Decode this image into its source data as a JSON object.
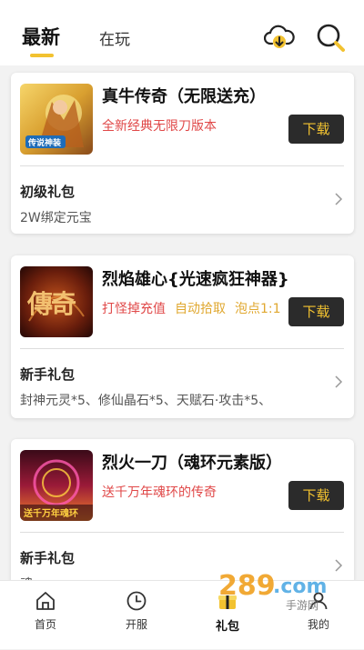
{
  "header": {
    "tabs": [
      {
        "label": "最新",
        "active": true
      },
      {
        "label": "在玩",
        "active": false
      }
    ],
    "icons": [
      "cloud-download-icon",
      "search-icon"
    ],
    "accent": "#f2c230"
  },
  "games": [
    {
      "title": "真牛传奇（无限送充）",
      "description": "全新经典无限刀版本",
      "tags": [],
      "thumb_text": "传说神装",
      "download_label": "下载",
      "gift_title": "初级礼包",
      "gift_content": "2W绑定元宝"
    },
    {
      "title": "烈焰雄心{光速疯狂神器}",
      "description": "",
      "tags": [
        {
          "text": "打怪掉充值",
          "color": "#e04848"
        },
        {
          "text": "自动拾取",
          "color": "#e0a830"
        },
        {
          "text": "泡点1:1",
          "color": "#e0a830"
        }
      ],
      "thumb_text": "傳奇",
      "download_label": "下载",
      "gift_title": "新手礼包",
      "gift_content": "封神元灵*5、修仙晶石*5、天赋石·攻击*5、"
    },
    {
      "title": "烈火一刀（魂环元素版）",
      "description": "送千万年魂环的传奇",
      "tags": [],
      "thumb_text": "送千万年魂环",
      "download_label": "下载",
      "gift_title": "新手礼包",
      "gift_content": "魂"
    }
  ],
  "bottom_nav": [
    {
      "label": "首页",
      "icon": "home-icon",
      "active": false
    },
    {
      "label": "开服",
      "icon": "clock-icon",
      "active": false
    },
    {
      "label": "礼包",
      "icon": "gift-icon",
      "active": true
    },
    {
      "label": "我的",
      "icon": "user-icon",
      "active": false
    }
  ],
  "watermark": "289.com"
}
